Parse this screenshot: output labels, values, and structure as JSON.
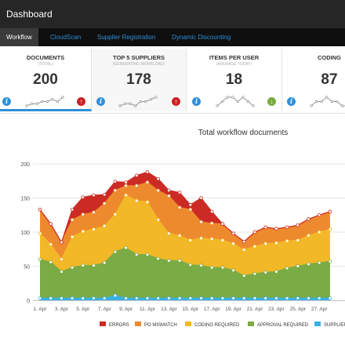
{
  "app": {
    "title": "Dashboard"
  },
  "nav": {
    "tabs": [
      {
        "label": "Workflow",
        "active": true
      },
      {
        "label": "CloudScan"
      },
      {
        "label": "Supplier Registration"
      },
      {
        "label": "Dynamic Discounting"
      }
    ]
  },
  "kpis": [
    {
      "title": "DOCUMENTS",
      "subtitle": "(TOTAL)",
      "value": "200",
      "trend": "up",
      "spark": [
        4,
        5,
        5,
        6,
        6,
        7,
        6,
        8
      ]
    },
    {
      "title": "TOP 5 SUPPLIERS",
      "subtitle": "(GENERATING WORKLOAD)",
      "value": "178",
      "trend": "up",
      "spark": [
        3,
        4,
        4,
        3,
        5,
        5,
        6,
        7
      ]
    },
    {
      "title": "ITEMS PER USER",
      "subtitle": "(AVERAGE TODAY)",
      "value": "18",
      "trend": "down",
      "spark": [
        5,
        6,
        7,
        7,
        6,
        7,
        6,
        5
      ]
    },
    {
      "title": "CODING",
      "subtitle": "",
      "value": "87",
      "trend": "",
      "spark": [
        5,
        6,
        6,
        7,
        6,
        6,
        5,
        5
      ]
    }
  ],
  "colors": {
    "accent": "#2f8fd8",
    "up": "#cc2222",
    "down": "#78a942"
  },
  "chart_data": {
    "type": "area",
    "title": "Total workflow documents",
    "x": [
      "1. Apr",
      "2. Apr",
      "3. Apr",
      "4. Apr",
      "5. Apr",
      "6. Apr",
      "7. Apr",
      "8. Apr",
      "9. Apr",
      "10. Apr",
      "11. Apr",
      "12. Apr",
      "13. Apr",
      "14. Apr",
      "15. Apr",
      "16. Apr",
      "17. Apr",
      "18. Apr",
      "19. Apr",
      "20. Apr",
      "21. Apr",
      "22. Apr",
      "23. Apr",
      "24. Apr",
      "25. Apr",
      "26. Apr",
      "27. Apr",
      "28. Apr"
    ],
    "tick_labels": [
      "1. Apr",
      "3. Apr",
      "5. Apr",
      "7. Apr",
      "9. Apr",
      "11. Apr",
      "13. Apr",
      "15. Apr",
      "17. Apr",
      "19. Apr",
      "21. Apr",
      "23. Apr",
      "25. Apr",
      "27. Apr"
    ],
    "ylim": [
      0,
      200
    ],
    "yticks": [
      0,
      50,
      100,
      150,
      200
    ],
    "grid": true,
    "legend_position": "bottom",
    "series": [
      {
        "name": "SUPPLIER",
        "color": "#3ab0e2",
        "values": [
          3,
          3,
          3,
          3,
          3,
          3,
          3,
          7,
          3,
          3,
          3,
          3,
          3,
          3,
          3,
          3,
          3,
          3,
          3,
          3,
          3,
          3,
          3,
          3,
          3,
          3,
          3,
          3
        ]
      },
      {
        "name": "APPROVAL REQUIRED",
        "color": "#7aab45",
        "values": [
          57,
          53,
          39,
          45,
          48,
          48,
          52,
          64,
          74,
          64,
          64,
          58,
          55,
          55,
          49,
          48,
          45,
          45,
          41,
          33,
          36,
          38,
          39,
          44,
          47,
          50,
          52,
          54
        ]
      },
      {
        "name": "CODING REQUIRED",
        "color": "#f2b827",
        "values": [
          38,
          26,
          18,
          45,
          50,
          53,
          54,
          55,
          77,
          79,
          77,
          57,
          40,
          37,
          36,
          40,
          42,
          40,
          39,
          38,
          40,
          42,
          42,
          40,
          38,
          42,
          45,
          47
        ]
      },
      {
        "name": "PO MISMATCH",
        "color": "#ee8a2e",
        "values": [
          35,
          30,
          25,
          25,
          25,
          25,
          33,
          35,
          14,
          22,
          29,
          43,
          55,
          41,
          45,
          24,
          23,
          24,
          15,
          12,
          21,
          24,
          21,
          20,
          22,
          24,
          25,
          26
        ]
      },
      {
        "name": "ERRORS",
        "color": "#cc2a24",
        "values": [
          0,
          0,
          0,
          15,
          25,
          25,
          13,
          13,
          5,
          15,
          15,
          17,
          8,
          22,
          7,
          35,
          17,
          0,
          0,
          0,
          0,
          0,
          0,
          0,
          0,
          0,
          0,
          0
        ]
      }
    ]
  }
}
